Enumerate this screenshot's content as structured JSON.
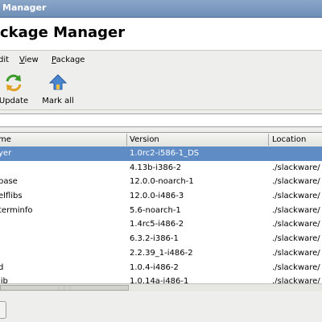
{
  "window": {
    "title": "Manager"
  },
  "header": {
    "title": "ckage Manager"
  },
  "menubar": {
    "items": [
      {
        "label_pre": "",
        "accel": "",
        "label_post": "dit"
      },
      {
        "label_pre": "",
        "accel": "V",
        "label_post": "iew"
      },
      {
        "label_pre": "",
        "accel": "P",
        "label_post": "ackage"
      }
    ]
  },
  "toolbar": {
    "update_label": "Update",
    "mark_all_label": "Mark all",
    "update_icon": "refresh-arrows-icon",
    "mark_all_icon": "up-arrow-house-icon"
  },
  "search": {
    "value": ""
  },
  "table": {
    "columns": [
      "me",
      "Version",
      "Location"
    ],
    "rows": [
      {
        "name": "yer",
        "version": "1.0rc2-i586-1_DS",
        "location": "",
        "selected": true
      },
      {
        "name": "",
        "version": "4.13b-i386-2",
        "location": "./slackware/"
      },
      {
        "name": "base",
        "version": "12.0.0-noarch-1",
        "location": "./slackware/"
      },
      {
        "name": "elflibs",
        "version": "12.0.0-i486-3",
        "location": "./slackware/"
      },
      {
        "name": "terminfo",
        "version": "5.6-noarch-1",
        "location": "./slackware/"
      },
      {
        "name": "",
        "version": "1.4rc5-i486-2",
        "location": "./slackware/"
      },
      {
        "name": "",
        "version": "6.3.2-i386-1",
        "location": "./slackware/"
      },
      {
        "name": "",
        "version": "2.2.39_1-i486-2",
        "location": "./slackware/"
      },
      {
        "name": "d",
        "version": "1.0.4-i486-2",
        "location": "./slackware/"
      },
      {
        "name": "lib",
        "version": "1.0.14a-i486-1",
        "location": "./slackware/"
      }
    ]
  },
  "colors": {
    "selection": "#5f8cc4",
    "titlebar": "#7c98c0"
  }
}
